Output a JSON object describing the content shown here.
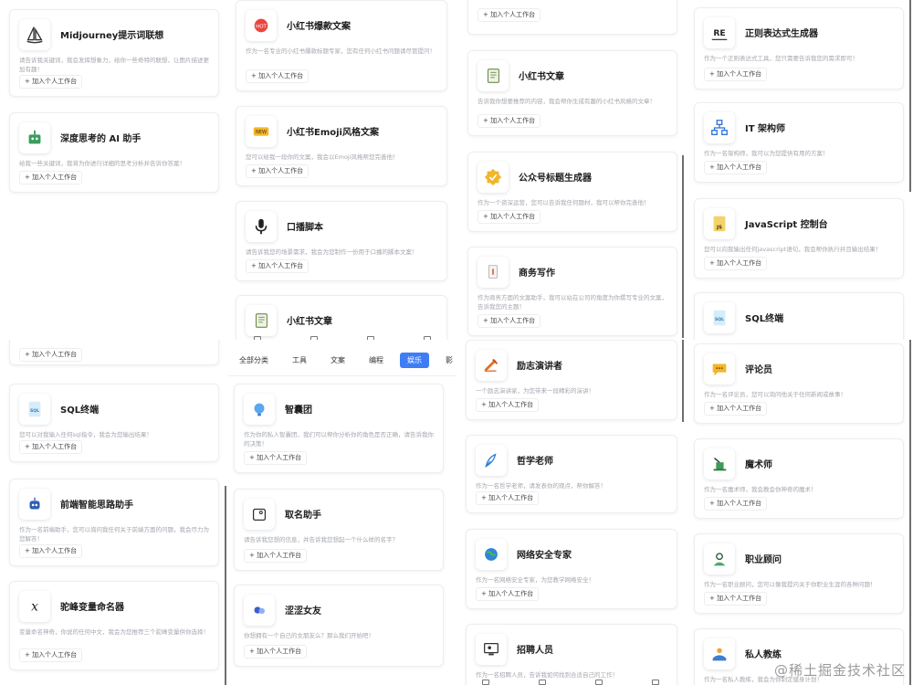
{
  "add_label": "+ 加入个人工作台",
  "q1": [
    {
      "title": "Midjourney提示词联想",
      "icon": "sailboat-icon",
      "desc": "请告诉我关键词，我会发挥想象力，给你一些奇特的联想，让图片描述更加有趣！"
    },
    {
      "title": "深度思考的 AI 助手",
      "icon": "robot-icon",
      "desc": "给我一些关键词，我将为你进行详细的思考分析并告诉你答案！"
    }
  ],
  "q2": [
    {
      "title": "小红书爆款文案",
      "icon": "hot-badge-icon",
      "desc": "作为一名专业的小红书爆款标题专家，您有任何小红书问题请尽管提问！"
    },
    {
      "title": "小红书Emoji风格文案",
      "icon": "new-tag-icon",
      "desc": "您可以给我一段你的文案，我会以Emoji风格帮您完善他！"
    },
    {
      "title": "口播脚本",
      "icon": "microphone-icon",
      "desc": "请告诉我您的场景需求，我会为您制作一份用于口播的脚本文案！"
    },
    {
      "title": "小红书文章",
      "icon": "notebook-icon",
      "desc": ""
    }
  ],
  "q3": [
    {
      "title": "",
      "icon": "",
      "desc": ""
    },
    {
      "title": "小红书文章",
      "icon": "notebook-icon",
      "desc": "告诉我你想要推荐的内容，我会帮你生成有趣的小红书风格的文章！"
    },
    {
      "title": "公众号标题生成器",
      "icon": "badge-check-icon",
      "desc": "作为一个资深运营，您可以告诉我任何题材，我可以帮你完善他！"
    },
    {
      "title": "商务写作",
      "icon": "document-pen-icon",
      "desc": "作为商务方面的文案助手，我可以站在公司的角度为你撰写专业的文案，告诉我您的主题！"
    }
  ],
  "q4": [
    {
      "title": "正则表达式生成器",
      "icon": "regex-icon",
      "desc": "作为一个正则表达式工具，您只需要告诉我您的需求即可！"
    },
    {
      "title": "IT 架构师",
      "icon": "hierarchy-icon",
      "desc": "作为一名架构师，我可以为您提供有用的方案！"
    },
    {
      "title": "JavaScript 控制台",
      "icon": "js-file-icon",
      "desc": "您可以向我输出任何javascript语句，我会帮你执行并且输出结果！"
    },
    {
      "title": "SQL终端",
      "icon": "sql-file-icon",
      "desc": ""
    }
  ],
  "q5": [
    {
      "title": "",
      "icon": "",
      "desc": ""
    },
    {
      "title": "SQL终端",
      "icon": "sql-file-icon",
      "desc": "您可以对我输入任何sql指令，我会为您输出结果！"
    },
    {
      "title": "前端智能思路助手",
      "icon": "bot-head-icon",
      "desc": "作为一名前端助手，您可以询问我任何关于前端方面的问题，我会尽力为您解答！"
    },
    {
      "title": "驼峰变量命名器",
      "icon": "variable-x-icon",
      "desc": "变量命名神奇，你说的任何中文，我会为您推荐三个驼峰变量供你选择！"
    }
  ],
  "q6_tabs": [
    "全部分类",
    "工具",
    "文案",
    "编程",
    "娱乐",
    "影"
  ],
  "q6": [
    {
      "title": "智囊团",
      "icon": "lightbulb-icon",
      "desc": "作为你的私人智囊团，我们可以帮你分析你的角色是否正确，请告诉我你的决策！"
    },
    {
      "title": "取名助手",
      "icon": "name-tag-icon",
      "desc": "请告诉我您想的信息，并告诉我您想起一个什么样的名字？"
    },
    {
      "title": "涩涩女友",
      "icon": "hearts-icon",
      "desc": "你想拥有一个自己的女朋友么？那么我们开始吧！"
    }
  ],
  "q7": [
    {
      "title": "励志演讲者",
      "icon": "megaphone-icon",
      "desc": "一个励志演讲家，为您带来一段精彩的演讲！"
    },
    {
      "title": "哲学老师",
      "icon": "feather-pen-icon",
      "desc": "作为一名哲学老师，请发表你的观点，帮你解答！"
    },
    {
      "title": "网络安全专家",
      "icon": "globe-shield-icon",
      "desc": "作为一名网络安全专家，为您教学网络安全！"
    },
    {
      "title": "招聘人员",
      "icon": "recruiter-screen-icon",
      "desc": "作为一名招聘人员，告诉我如何找到合适自己的工作！"
    }
  ],
  "q8": [
    {
      "title": "评论员",
      "icon": "speech-bubble-icon",
      "desc": "作为一名评论员，您可以询问他关于任何新闻或故事！"
    },
    {
      "title": "魔术师",
      "icon": "magic-hat-icon",
      "desc": "作为一名魔术师，我会教会你神奇的魔术！"
    },
    {
      "title": "职业顾问",
      "icon": "person-advisor-icon",
      "desc": "作为一名职业顾问，您可以像我提问关于你职业生涯的各种问题！"
    },
    {
      "title": "私人教练",
      "icon": "dumbbell-trainer-icon",
      "desc": "作为一名私人教练，我会为你制定健身计划！"
    }
  ],
  "watermark": "@稀土掘金技术社区"
}
